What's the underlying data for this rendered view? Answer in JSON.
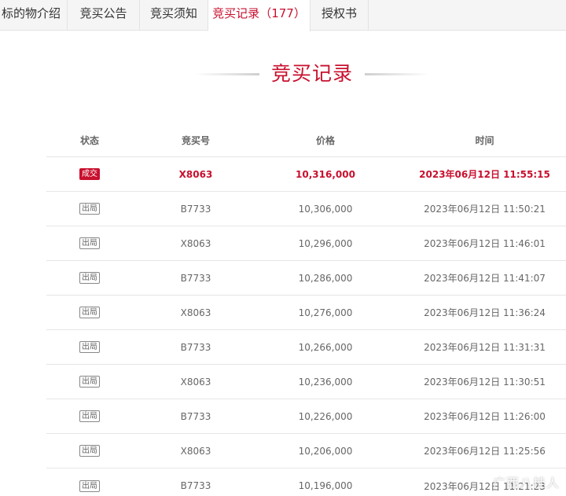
{
  "tabs": [
    {
      "label": "标的物介绍",
      "active": false
    },
    {
      "label": "竞买公告",
      "active": false
    },
    {
      "label": "竞买须知",
      "active": false
    },
    {
      "label": "竞买记录",
      "count": "（177）",
      "active": true
    },
    {
      "label": "授权书",
      "active": false
    }
  ],
  "section_title": "竞买记录",
  "table": {
    "headers": [
      "状态",
      "竞买号",
      "价格",
      "时间"
    ],
    "rows": [
      {
        "status": "成交",
        "bidder": "X8063",
        "price": "10,316,000",
        "time": "2023年06月12日 11:55:15"
      },
      {
        "status": "出局",
        "bidder": "B7733",
        "price": "10,306,000",
        "time": "2023年06月12日 11:50:21"
      },
      {
        "status": "出局",
        "bidder": "X8063",
        "price": "10,296,000",
        "time": "2023年06月12日 11:46:01"
      },
      {
        "status": "出局",
        "bidder": "B7733",
        "price": "10,286,000",
        "time": "2023年06月12日 11:41:07"
      },
      {
        "status": "出局",
        "bidder": "X8063",
        "price": "10,276,000",
        "time": "2023年06月12日 11:36:24"
      },
      {
        "status": "出局",
        "bidder": "B7733",
        "price": "10,266,000",
        "time": "2023年06月12日 11:31:31"
      },
      {
        "status": "出局",
        "bidder": "X8063",
        "price": "10,236,000",
        "time": "2023年06月12日 11:30:51"
      },
      {
        "status": "出局",
        "bidder": "B7733",
        "price": "10,226,000",
        "time": "2023年06月12日 11:26:00"
      },
      {
        "status": "出局",
        "bidder": "X8063",
        "price": "10,206,000",
        "time": "2023年06月12日 11:25:56"
      },
      {
        "status": "出局",
        "bidder": "B7733",
        "price": "10,196,000",
        "time": "2023年06月12日 11:21:23"
      }
    ]
  },
  "watermark": "广西八桂人",
  "colors": {
    "accent": "#c8102e",
    "tab_bg": "#f5f5f5",
    "border": "#e6e6e6"
  }
}
